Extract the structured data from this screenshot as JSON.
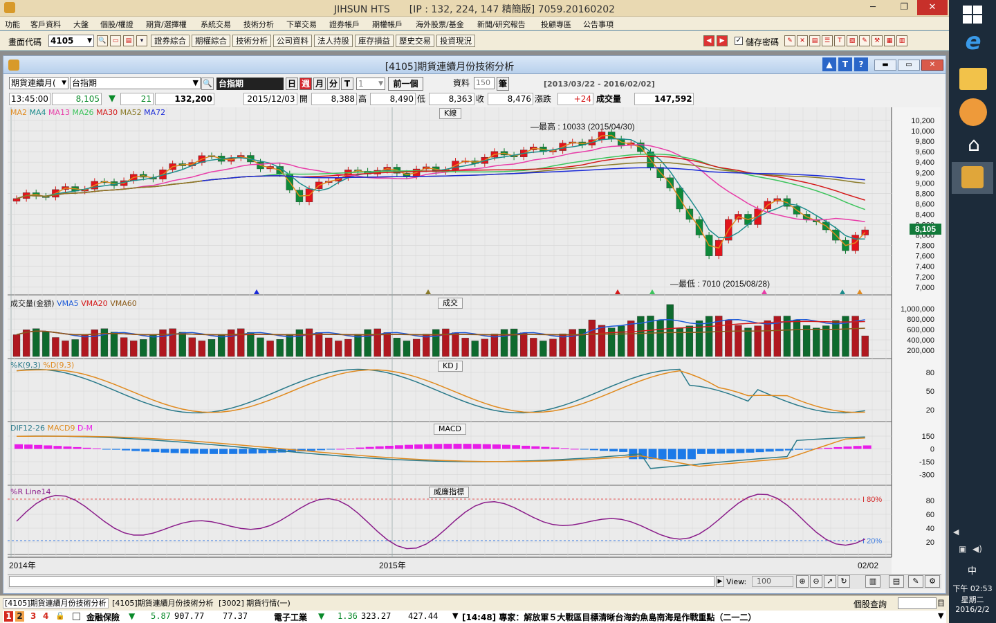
{
  "app": {
    "title": "JIHSUN HTS　　[IP : 132, 224, 147 精簡版] 7059.20160202",
    "win_min": "─",
    "win_restore": "❐",
    "win_close": "✕"
  },
  "menu": [
    "功能",
    "客戶資料",
    "大盤",
    "個股/權證",
    "期貨/選擇權",
    "系統交易",
    "技術分析",
    "下單交易",
    "證券帳戶",
    "期權帳戶",
    "海外股票/基金",
    "新聞/研究報告",
    "投顧專區",
    "公告事項"
  ],
  "toolbar": {
    "code_label": "畫面代碼",
    "code_value": "4105",
    "buttons": [
      "證券綜合",
      "期權綜合",
      "技術分析",
      "公司資料",
      "法人持股",
      "庫存損益",
      "歷史交易",
      "投資現況"
    ],
    "save_pwd": "儲存密碼",
    "save_checked": "✓"
  },
  "child": {
    "title": "[4105]期貨連續月份技術分析"
  },
  "controls": {
    "product_type": "期貨連續月(",
    "product": "台指期",
    "product_badge": "台指期",
    "day": "日",
    "week": "週",
    "month": "月",
    "minute": "分",
    "tick": "T",
    "period_value": "1",
    "prev_btn": "前一個",
    "data_label": "資料",
    "data_count": "150",
    "data_unit": "筆",
    "range": "[2013/03/22 - 2016/02/02]"
  },
  "quote": {
    "time": "13:45:00",
    "price": "8,105",
    "arrow": "▼",
    "change": "21",
    "volume": "132,200",
    "date": "2015/12/03",
    "open_label": "開",
    "open": "8,388",
    "high_label": "高",
    "high": "8,490",
    "low_label": "低",
    "low": "8,363",
    "close_label": "收",
    "close": "8,476",
    "chg_label": "漲跌",
    "chg": "+24",
    "vol_label": "成交量",
    "vol": "147,592"
  },
  "panels": {
    "k": {
      "tag": "K線",
      "legend": [
        {
          "name": "MA2",
          "color": "#e08a1e"
        },
        {
          "name": "MA4",
          "color": "#1c8c8c"
        },
        {
          "name": "MA13",
          "color": "#e83ca8"
        },
        {
          "name": "MA26",
          "color": "#3cc45c"
        },
        {
          "name": "MA30",
          "color": "#d41818"
        },
        {
          "name": "MA52",
          "color": "#8a7a28"
        },
        {
          "name": "MA72",
          "color": "#1a2ad8"
        }
      ],
      "yticks": [
        "10,200",
        "10,000",
        "9,800",
        "9,600",
        "9,400",
        "9,200",
        "9,000",
        "8,800",
        "8,600",
        "8,400",
        "8,200",
        "8,000",
        "7,800",
        "7,600",
        "7,400",
        "7,200",
        "7,000"
      ],
      "last_price": "8,105",
      "high_note": "最高 : 10033 (2015/04/30)",
      "low_note": "最低 : 7010 (2015/08/28)"
    },
    "vol": {
      "tag": "成交",
      "legend": [
        {
          "name": "成交量(金額)",
          "color": "#222"
        },
        {
          "name": "VMA5",
          "color": "#1c5ad8"
        },
        {
          "name": "VMA20",
          "color": "#d41818"
        },
        {
          "name": "VMA60",
          "color": "#8a5a18"
        }
      ],
      "yticks": [
        "1,000,000",
        "800,000",
        "600,000",
        "400,000",
        "200,000"
      ]
    },
    "kd": {
      "tag": "KD J",
      "legend": [
        {
          "name": "%K(9,3)",
          "color": "#2a7a8a"
        },
        {
          "name": "%D(9,3)",
          "color": "#e08a1e"
        }
      ],
      "yticks": [
        "80",
        "50",
        "20"
      ]
    },
    "macd": {
      "tag": "MACD",
      "legend": [
        {
          "name": "DIF12-26",
          "color": "#2a7a8a"
        },
        {
          "name": "MACD9",
          "color": "#e08a1e"
        },
        {
          "name": "D-M",
          "color": "#e81ce8"
        }
      ],
      "yticks": [
        "150",
        "0",
        "-150",
        "-300"
      ]
    },
    "wr": {
      "tag": "威廉指標",
      "legend": [
        {
          "name": "%R Line14",
          "color": "#8a1c8a"
        }
      ],
      "yticks": [
        "80",
        "60",
        "40",
        "20"
      ],
      "line80": "80%",
      "line20": "20%"
    }
  },
  "xaxis": {
    "labels": [
      "2014年",
      "2015年",
      "02/02"
    ]
  },
  "scroll": {
    "view_label": "View:",
    "view_value": "100"
  },
  "tabs": [
    "[4105]期貨連續月份技術分析",
    "[4105]期貨連續月份技術分析",
    "[3002] 期貨行情(一)"
  ],
  "stock_query": {
    "label": "個股查詢",
    "btn": "目"
  },
  "ticker": {
    "items": [
      {
        "name": "金融保險",
        "arrow": "▼",
        "chg": "5.87",
        "val": "907.77",
        "vol": "77.37"
      },
      {
        "name": "電子工業",
        "arrow": "▼",
        "chg": "1.36",
        "val": "323.27",
        "vol": "427.44"
      }
    ],
    "news": "[14:48] 專家：解放軍５大戰區目標清晰台海釣魚島南海是作戰重點（二一二）",
    "nums": [
      "1",
      "2",
      "3",
      "4"
    ]
  },
  "taskbar": {
    "time": "下午 02:53",
    "weekday": "星期二",
    "date": "2016/2/2",
    "ime": "中"
  }
}
